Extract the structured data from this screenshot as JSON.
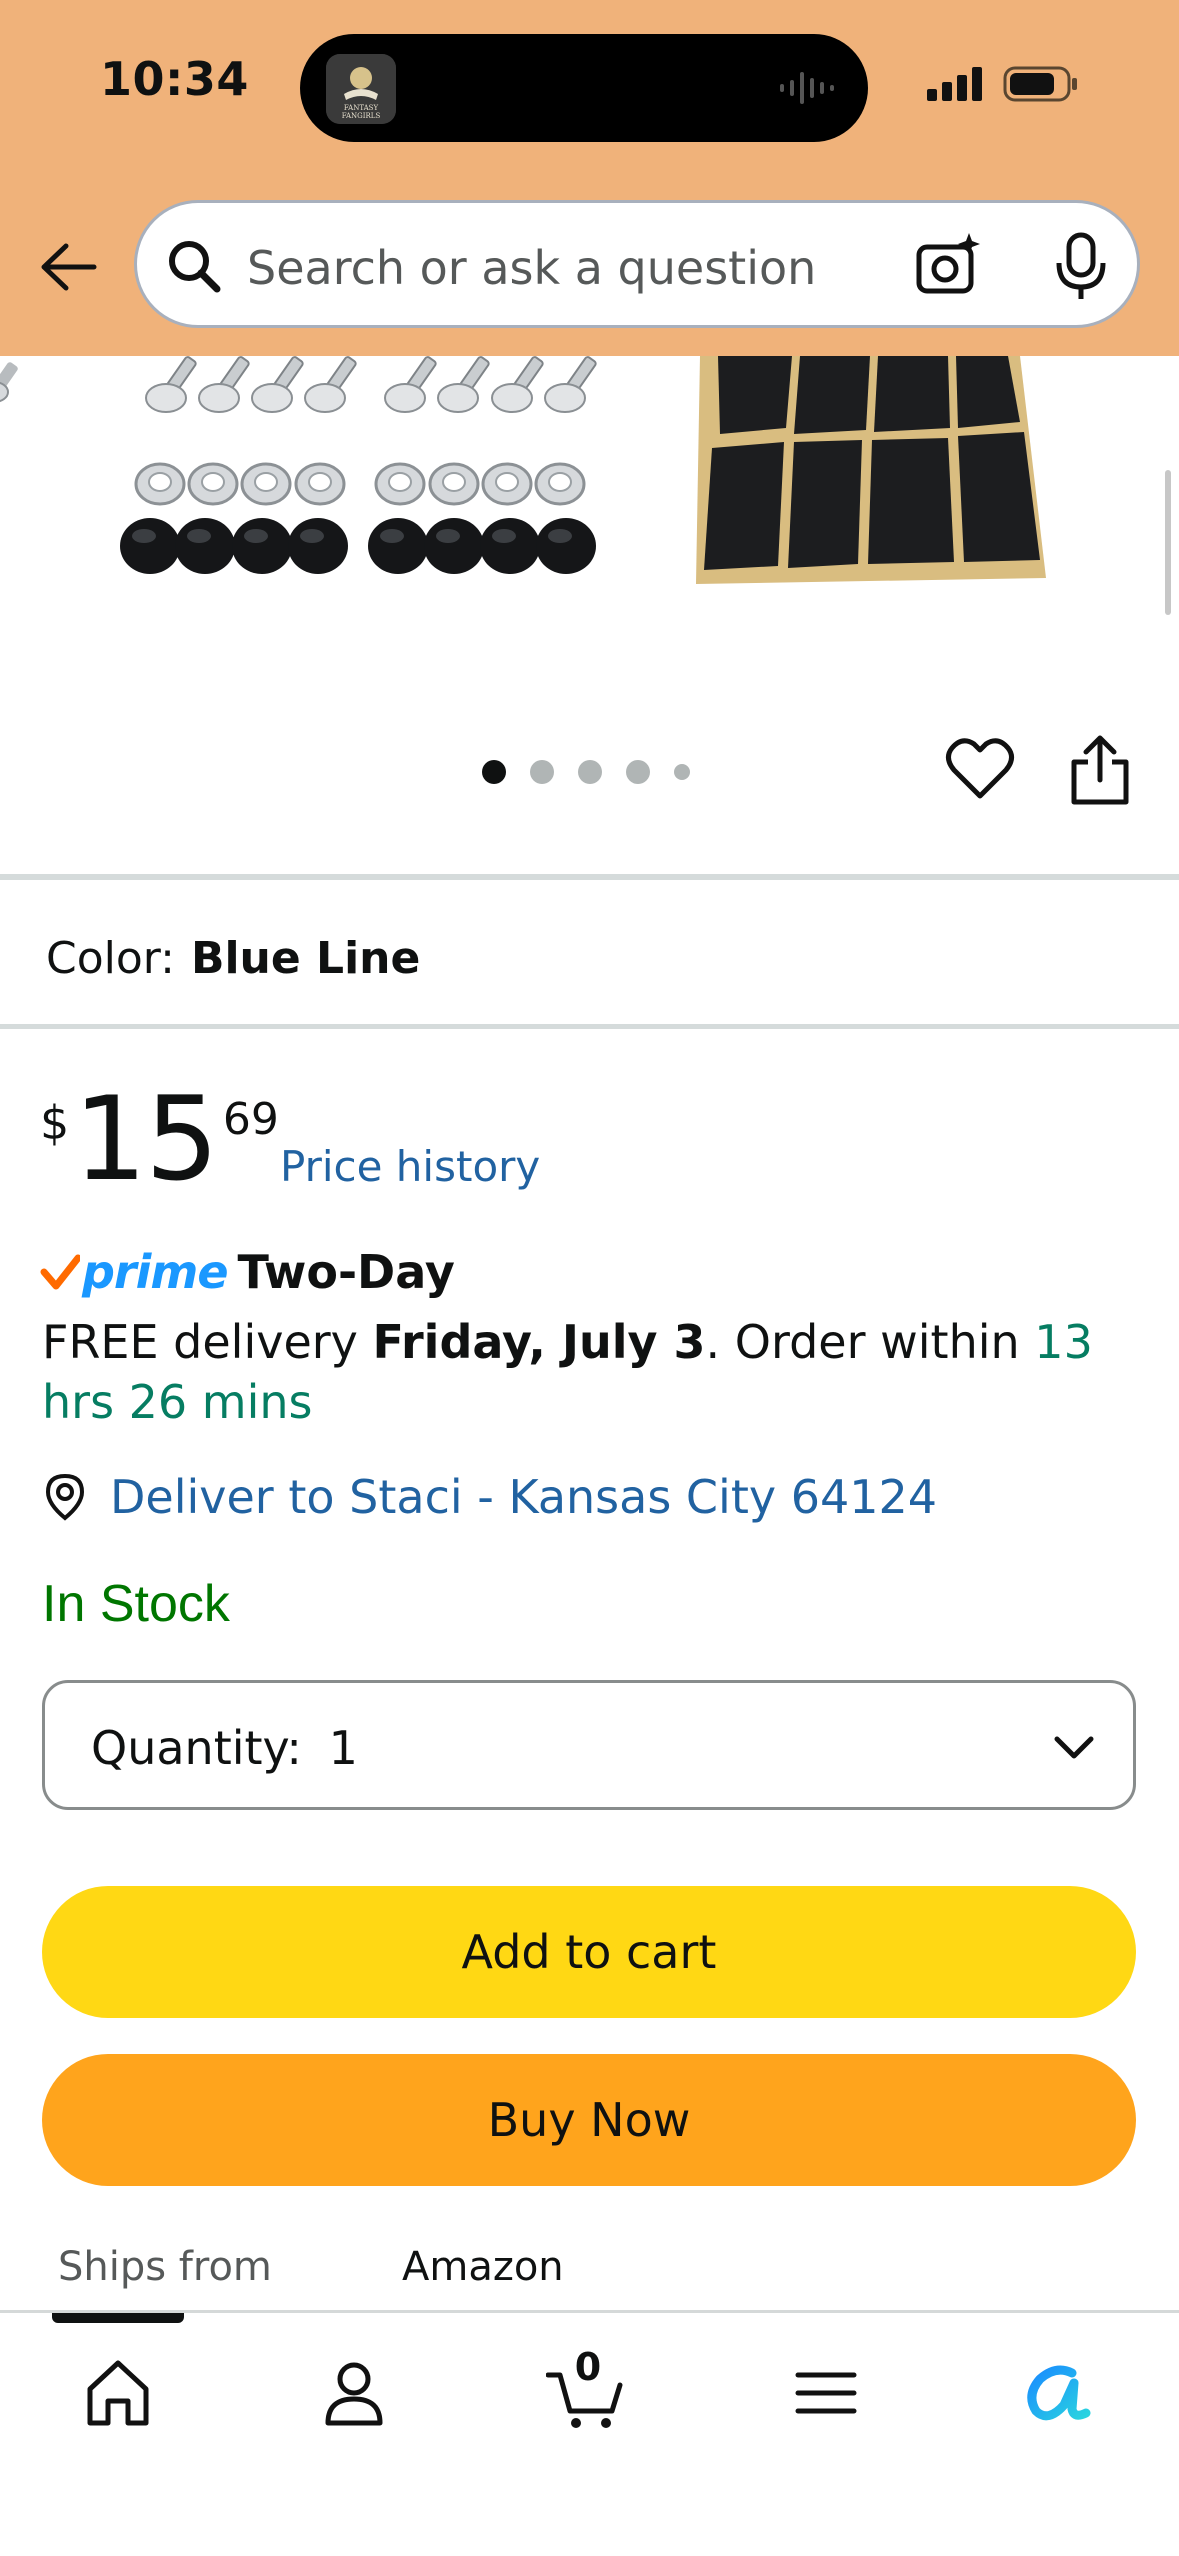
{
  "status_bar": {
    "time": "10:34",
    "island_app": "FANTASY FANGIRLS"
  },
  "header": {
    "search_placeholder": "Search or ask a question",
    "accent_color": "#f0b27a"
  },
  "gallery": {
    "total_dots": 5,
    "active_dot": 1
  },
  "product": {
    "color_label": "Color:",
    "color_value": "Blue Line",
    "price_symbol": "$",
    "price_whole": "15",
    "price_fraction": "69",
    "price_history_label": "Price history",
    "prime_label": "prime",
    "prime_speed": "Two-Day",
    "delivery_prefix": "FREE delivery ",
    "delivery_date": "Friday, July 3",
    "delivery_middle": ". Order within ",
    "delivery_countdown": "13 hrs 26 mins",
    "deliver_to": "Deliver to Staci - Kansas City 64124",
    "stock_status": "In Stock",
    "quantity_label": "Quantity:",
    "quantity_value": "1",
    "add_to_cart": "Add to cart",
    "buy_now": "Buy Now",
    "ships_from_label": "Ships from",
    "ships_from_value": "Amazon"
  },
  "bottom_nav": {
    "cart_count": "0",
    "items": [
      "home",
      "account",
      "cart",
      "menu",
      "rufus"
    ]
  }
}
